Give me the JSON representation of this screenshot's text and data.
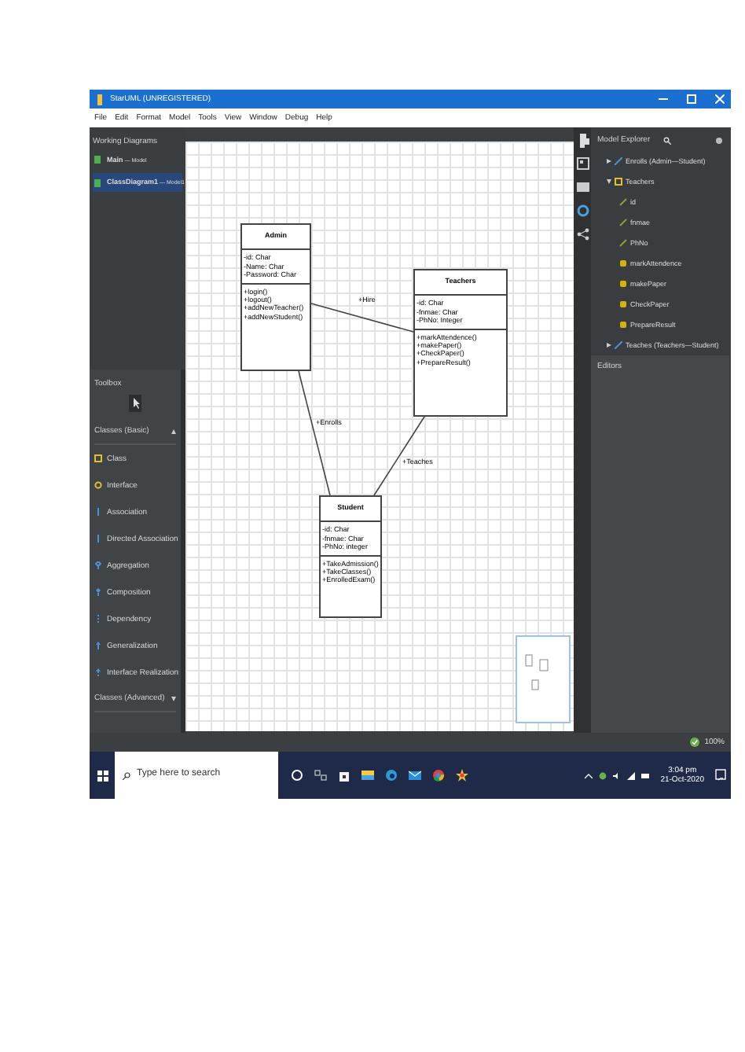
{
  "window": {
    "title": "StarUML (UNREGISTERED)"
  },
  "menu": [
    "File",
    "Edit",
    "Format",
    "Model",
    "Tools",
    "View",
    "Window",
    "Debug",
    "Help"
  ],
  "working_diagrams": {
    "title": "Working Diagrams",
    "items": [
      {
        "name": "Main",
        "detail": "— Model",
        "selected": false
      },
      {
        "name": "ClassDiagram1",
        "detail": "— Model1",
        "selected": true
      }
    ]
  },
  "toolbox": {
    "title": "Toolbox",
    "groups": [
      {
        "title": "Classes (Basic)",
        "expanded": true,
        "items": [
          {
            "label": "Class",
            "kind": "class"
          },
          {
            "label": "Interface",
            "kind": "interface"
          },
          {
            "label": "Association",
            "kind": "association"
          },
          {
            "label": "Directed Association",
            "kind": "directed"
          },
          {
            "label": "Aggregation",
            "kind": "aggregation"
          },
          {
            "label": "Composition",
            "kind": "composition"
          },
          {
            "label": "Dependency",
            "kind": "dependency"
          },
          {
            "label": "Generalization",
            "kind": "generalization"
          },
          {
            "label": "Interface Realization",
            "kind": "realization"
          }
        ]
      },
      {
        "title": "Classes (Advanced)",
        "expanded": false
      }
    ]
  },
  "diagram": {
    "classes": [
      {
        "name": "Admin",
        "attributes": [
          "-id: Char",
          "-Name: Char",
          "-Password: Char"
        ],
        "operations": [
          "+login()",
          "+logout()",
          "+addNewTeacher()",
          "+addNewStudent()"
        ]
      },
      {
        "name": "Teachers",
        "attributes": [
          "-id: Char",
          "-fnmae: Char",
          "-PhNo: Integer"
        ],
        "operations": [
          "+markAttendence()",
          "+makePaper()",
          "+CheckPaper()",
          "+PrepareResult()"
        ]
      },
      {
        "name": "Student",
        "attributes": [
          "-id: Char",
          "-fnmae: Char",
          "-PhNo: integer"
        ],
        "operations": [
          "+TakeAdmission()",
          "+TakeClasses()",
          "+EnrolledExam()"
        ]
      }
    ],
    "associations": [
      {
        "label": "+Hire"
      },
      {
        "label": "+Enrolls"
      },
      {
        "label": "+Teaches"
      }
    ]
  },
  "model_explorer": {
    "title": "Model Explorer",
    "items": [
      {
        "label": "Enrolls (Admin—Student)",
        "kind": "association",
        "expanded": false
      },
      {
        "label": "Teachers",
        "kind": "class",
        "expanded": true,
        "children": [
          {
            "label": "id",
            "kind": "attribute"
          },
          {
            "label": "fnmae",
            "kind": "attribute"
          },
          {
            "label": "PhNo",
            "kind": "attribute"
          },
          {
            "label": "markAttendence",
            "kind": "operation"
          },
          {
            "label": "makePaper",
            "kind": "operation"
          },
          {
            "label": "CheckPaper",
            "kind": "operation"
          },
          {
            "label": "PrepareResult",
            "kind": "operation"
          }
        ]
      },
      {
        "label": "Teaches (Teachers—Student)",
        "kind": "association",
        "expanded": false
      }
    ]
  },
  "editors": {
    "title": "Editors"
  },
  "status_bar": {
    "zoom": "100%"
  },
  "taskbar": {
    "search_placeholder": "Type here to search",
    "time": "3:04 pm",
    "date": "21-Oct-2020"
  }
}
